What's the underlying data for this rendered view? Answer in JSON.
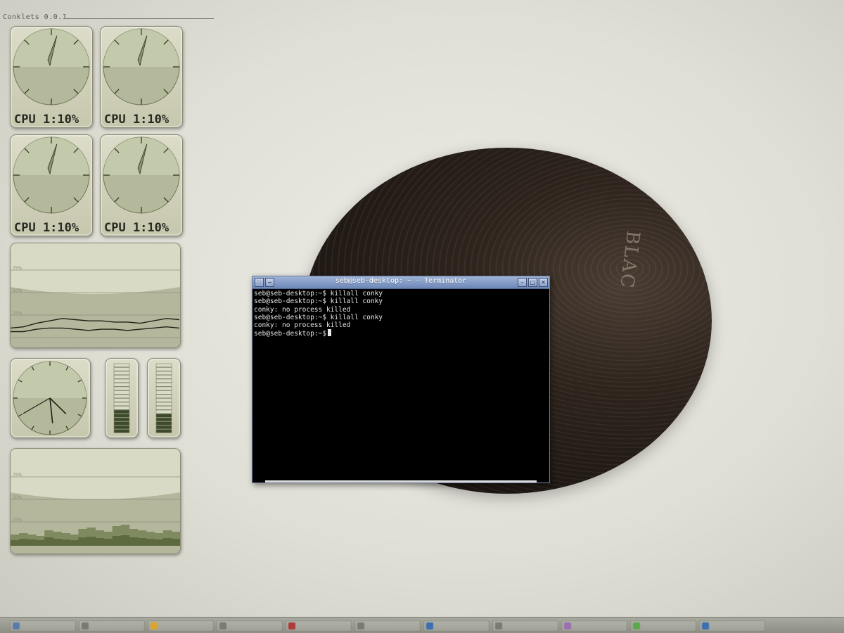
{
  "desktop": {
    "wallpaper_label": "BLAC"
  },
  "conky": {
    "title": "Conklets 0.0.1",
    "cpu_gauges": [
      {
        "label": "CPU 1:10%",
        "percent": 10
      },
      {
        "label": "CPU 1:10%",
        "percent": 10
      },
      {
        "label": "CPU 1:10%",
        "percent": 10
      },
      {
        "label": "CPU 1:10%",
        "percent": 10
      }
    ],
    "graph1": {
      "tick_labels": [
        "75%",
        "50%",
        "25%"
      ],
      "series_a": [
        8,
        9,
        12,
        14,
        16,
        15,
        14,
        14,
        13,
        13,
        12,
        14,
        16,
        15
      ],
      "series_b": [
        5,
        5,
        7,
        8,
        8,
        7,
        6,
        7,
        7,
        6,
        7,
        8,
        9,
        8
      ]
    },
    "clock": {
      "hour": 4,
      "minute": 29,
      "second": 40
    },
    "bar_meters": [
      {
        "level": 0.35
      },
      {
        "level": 0.25
      }
    ],
    "graph2": {
      "tick_labels": [
        "75%",
        "50%",
        "25%"
      ],
      "bars_a": [
        16,
        18,
        16,
        14,
        22,
        20,
        18,
        16,
        24,
        26,
        22,
        20,
        28,
        30,
        24,
        22,
        20,
        18,
        22,
        20
      ],
      "bars_b": [
        8,
        10,
        9,
        8,
        12,
        10,
        9,
        8,
        12,
        13,
        11,
        10,
        14,
        15,
        12,
        11,
        10,
        9,
        11,
        10
      ]
    },
    "colors": {
      "accent": "#3d4a2a",
      "dial": "#b3b99a",
      "dial_dark": "#8d9671"
    }
  },
  "terminal": {
    "title": "seb@seb-desktop: ~ - Terminator",
    "lines": [
      "seb@seb-desktop:~$ killall conky",
      "seb@seb-desktop:~$ killall conky",
      "conky: no process killed",
      "seb@seb-desktop:~$ killall conky",
      "conky: no process killed",
      "seb@seb-desktop:~$"
    ],
    "buttons": {
      "grid": "∷",
      "menu": "−",
      "minimize": "–",
      "maximize": "□",
      "close": "✕"
    }
  },
  "taskbar": {
    "items": [
      {
        "color": "#5a7aa8"
      },
      {
        "color": "#7a7b72"
      },
      {
        "color": "#d9a52b"
      },
      {
        "color": "#7a7b72"
      },
      {
        "color": "#b03a3a"
      },
      {
        "color": "#7a7b72"
      },
      {
        "color": "#3a6fb0"
      },
      {
        "color": "#7a7b72"
      },
      {
        "color": "#9b6fb0"
      },
      {
        "color": "#5aa84a"
      },
      {
        "color": "#3a6fb0"
      }
    ]
  }
}
